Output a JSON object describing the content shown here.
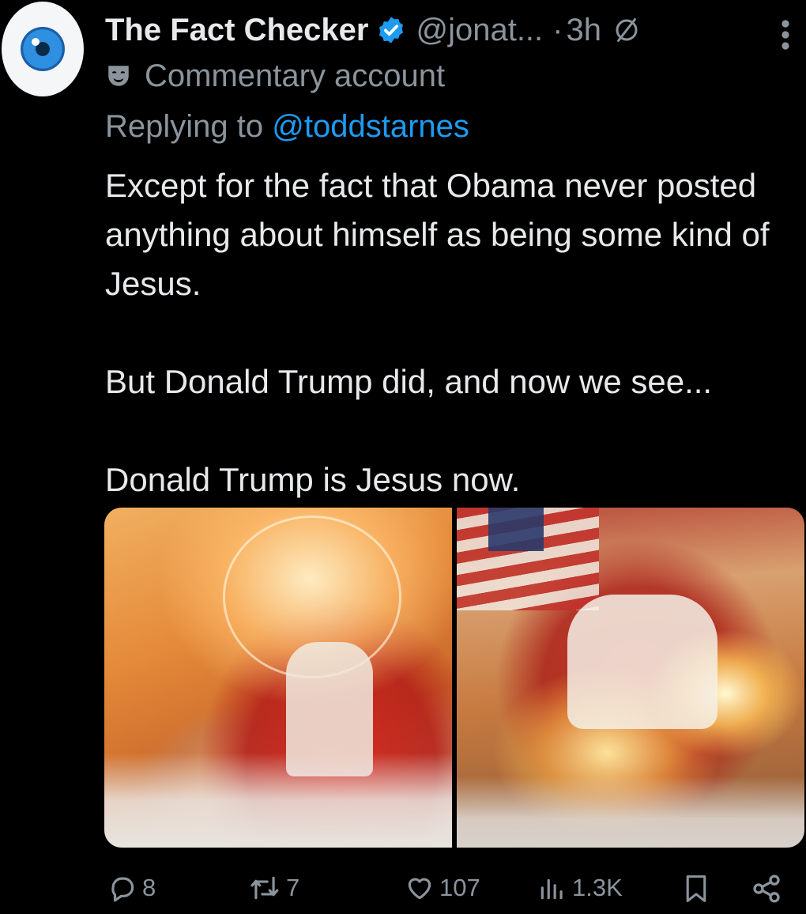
{
  "author": {
    "name": "The Fact Checker",
    "handle": "@jonat...",
    "separator": "·",
    "time": "3h",
    "label": "Commentary account",
    "avatar_icon": "eye-icon",
    "verified_color": "#1d9bf0"
  },
  "reply": {
    "prefix": "Replying to",
    "mention": "@toddstarnes"
  },
  "tweet": {
    "paragraphs": [
      "Except for the fact that Obama never posted anything about himself as being some kind of Jesus.",
      "But Donald Trump did, and now we see...",
      "Donald Trump is Jesus now."
    ]
  },
  "media": {
    "count": 2,
    "images": [
      {
        "subject": "jesus-healing-painting"
      },
      {
        "subject": "trump-healing-painting"
      }
    ]
  },
  "actions": {
    "replies": "8",
    "reposts": "7",
    "likes": "107",
    "views": "1.3K"
  },
  "colors": {
    "background": "#000000",
    "text": "#e7e9ea",
    "muted": "#8b949c",
    "accent": "#1d9bf0"
  }
}
